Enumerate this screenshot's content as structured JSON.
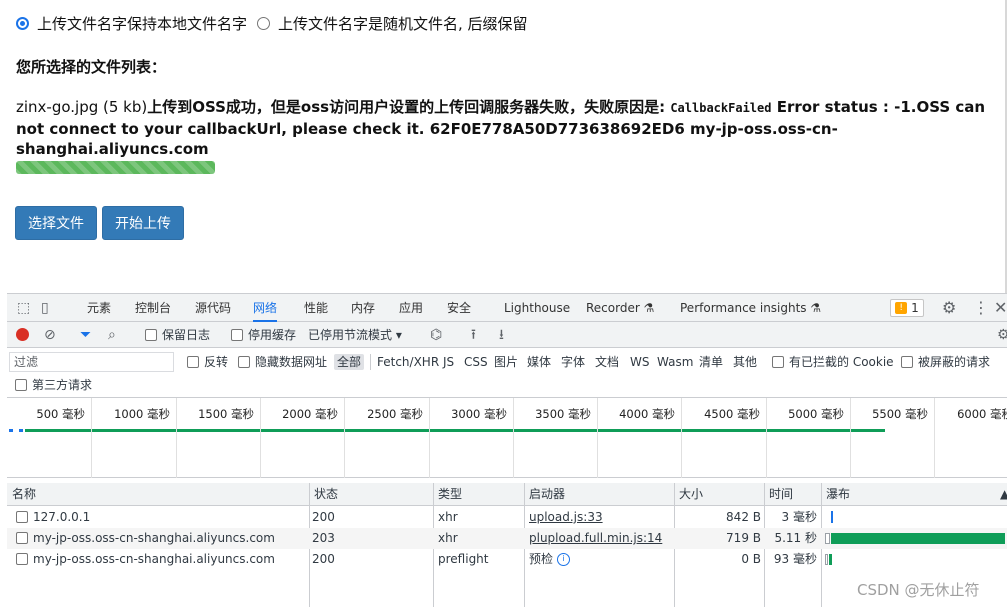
{
  "page": {
    "radio_keep_name": "上传文件名字保持本地文件名字",
    "radio_random_name": "上传文件名字是随机文件名, 后缀保留",
    "file_list_title": "您所选择的文件列表：",
    "file_name": "zinx-go.jpg (5 kb)",
    "upload_result_prefix": "上传到OSS成功，但是oss访问用户设置的上传回调服务器失败，失败原因是: ",
    "error_code": "CallbackFailed",
    "error_message": " Error status : -1.OSS can not connect to your callbackUrl, please check it. 62F0E778A50D773638692ED6 my-jp-oss.oss-cn-shanghai.aliyuncs.com",
    "progress": 1.0,
    "select_button": "选择文件",
    "upload_button": "开始上传"
  },
  "devtools": {
    "tabs": [
      "元素",
      "控制台",
      "源代码",
      "网络",
      "性能",
      "内存",
      "应用",
      "安全",
      "Lighthouse",
      "Recorder ⚗",
      "Performance insights ⚗"
    ],
    "active_tab": "网络",
    "issues_count": "1",
    "toolbar": {
      "preserve_log": "保留日志",
      "disable_cache": "停用缓存",
      "throttling": "已停用节流模式 ▾"
    },
    "filter": {
      "placeholder": "过滤",
      "invert": "反转",
      "hide_data_urls": "隐藏数据网址",
      "types": [
        "全部",
        "Fetch/XHR",
        "JS",
        "CSS",
        "图片",
        "媒体",
        "字体",
        "文档",
        "WS",
        "Wasm",
        "清单",
        "其他"
      ],
      "blocked_cookies": "有已拦截的 Cookie",
      "blocked_requests": "被屏蔽的请求",
      "third_party": "第三方请求"
    },
    "timeline_ticks": [
      "500 毫秒",
      "1000 毫秒",
      "1500 毫秒",
      "2000 毫秒",
      "2500 毫秒",
      "3000 毫秒",
      "3500 毫秒",
      "4000 毫秒",
      "4500 毫秒",
      "5000 毫秒",
      "5500 毫秒",
      "6000 毫秒"
    ],
    "columns": {
      "name": "名称",
      "status": "状态",
      "type": "类型",
      "initiator": "启动器",
      "size": "大小",
      "time": "时间",
      "waterfall": "瀑布"
    },
    "rows": [
      {
        "name": "127.0.0.1",
        "status": "200",
        "type": "xhr",
        "initiator": "upload.js:33",
        "size": "842 B",
        "time": "3 毫秒"
      },
      {
        "name": "my-jp-oss.oss-cn-shanghai.aliyuncs.com",
        "status": "203",
        "type": "xhr",
        "initiator": "plupload.full.min.js:14",
        "size": "719 B",
        "time": "5.11 秒"
      },
      {
        "name": "my-jp-oss.oss-cn-shanghai.aliyuncs.com",
        "status": "200",
        "type": "preflight",
        "initiator": "预检",
        "size": "0 B",
        "time": "93 毫秒"
      }
    ]
  },
  "watermark": "CSDN @无休止符"
}
